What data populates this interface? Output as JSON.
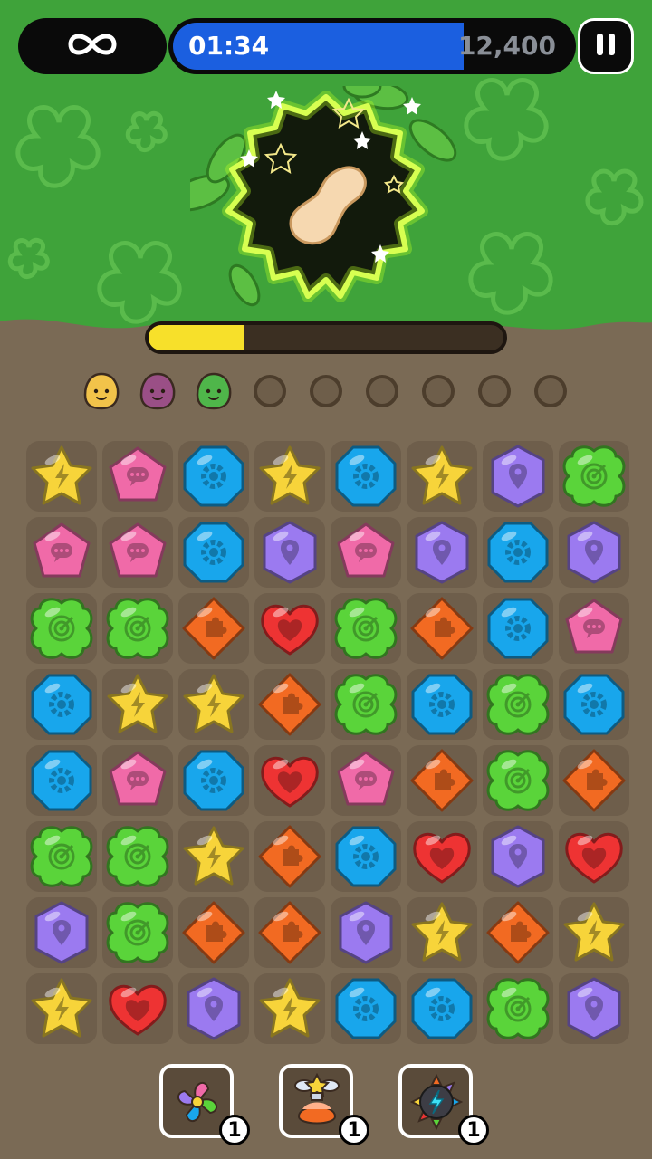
{
  "hud": {
    "mode_icon": "infinity-icon",
    "timer": "01:34",
    "score": "12,400",
    "timer_remaining_fraction": 0.73,
    "pause_icon": "pause-icon"
  },
  "portal": {
    "item": "peanut",
    "progress_fraction": 0.27
  },
  "creatures": {
    "collected": [
      {
        "name": "yellow-creature",
        "color": "#f2c34a"
      },
      {
        "name": "purple-creature",
        "color": "#9a4f86"
      },
      {
        "name": "green-creature",
        "color": "#4fb64a"
      }
    ],
    "empty_slots": 6
  },
  "board": {
    "rows": [
      [
        "yellow",
        "pink",
        "blue",
        "yellow",
        "blue",
        "yellow",
        "purple",
        "green"
      ],
      [
        "pink",
        "pink",
        "blue",
        "purple",
        "pink",
        "purple",
        "blue",
        "purple"
      ],
      [
        "green",
        "green",
        "orange",
        "red",
        "green",
        "orange",
        "blue",
        "pink"
      ],
      [
        "blue",
        "yellow",
        "yellow",
        "orange",
        "green",
        "blue",
        "green",
        "blue"
      ],
      [
        "blue",
        "pink",
        "blue",
        "red",
        "pink",
        "orange",
        "green",
        "orange"
      ],
      [
        "green",
        "green",
        "yellow",
        "orange",
        "blue",
        "red",
        "purple",
        "red"
      ],
      [
        "purple",
        "green",
        "orange",
        "orange",
        "purple",
        "yellow",
        "orange",
        "yellow"
      ],
      [
        "yellow",
        "red",
        "purple",
        "yellow",
        "blue",
        "blue",
        "green",
        "purple"
      ]
    ],
    "gem_types": {
      "yellow": {
        "icon": "lightning-gem-icon",
        "color": "#f7d43a"
      },
      "pink": {
        "icon": "chat-gem-icon",
        "color": "#f06aa8"
      },
      "blue": {
        "icon": "gear-gem-icon",
        "color": "#18a6ec"
      },
      "purple": {
        "icon": "pin-gem-icon",
        "color": "#9b7af0"
      },
      "green": {
        "icon": "target-gem-icon",
        "color": "#5ad43a"
      },
      "orange": {
        "icon": "puzzle-gem-icon",
        "color": "#f26a22"
      },
      "red": {
        "icon": "heart-gem-icon",
        "color": "#ee3333"
      }
    }
  },
  "boosters": [
    {
      "icon": "pinwheel-booster-icon",
      "count": "1"
    },
    {
      "icon": "potion-booster-icon",
      "count": "1"
    },
    {
      "icon": "bomb-booster-icon",
      "count": "1"
    }
  ]
}
